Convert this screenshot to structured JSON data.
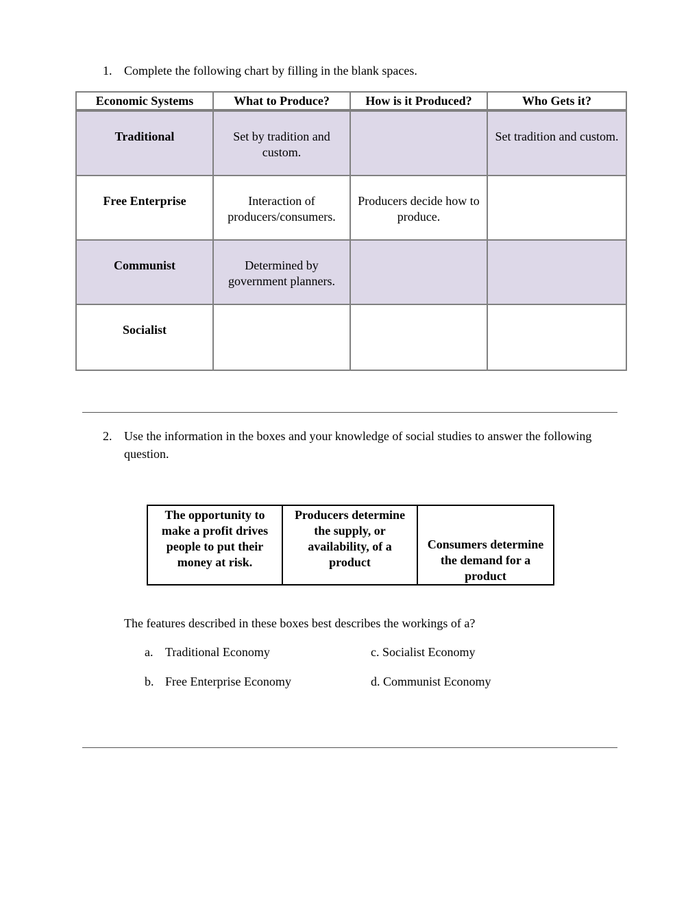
{
  "question1": {
    "number": "1.",
    "text": "Complete the following chart by filling in the blank spaces.",
    "table": {
      "headers": [
        "Economic Systems",
        "What to Produce?",
        "How is it Produced?",
        "Who Gets it?"
      ],
      "rows": [
        {
          "system": "Traditional",
          "what": "Set by tradition and custom.",
          "how": "",
          "who": "Set tradition and custom."
        },
        {
          "system": "Free Enterprise",
          "what": "Interaction of producers/consumers.",
          "how": "Producers decide how to produce.",
          "who": ""
        },
        {
          "system": "Communist",
          "what": "Determined by government planners.",
          "how": "",
          "who": ""
        },
        {
          "system": "Socialist",
          "what": "",
          "how": "",
          "who": ""
        }
      ],
      "shade_color": "#ddd8e8",
      "border_color": "#808080"
    }
  },
  "question2": {
    "number": "2.",
    "text": "Use the information in the boxes and your knowledge of social studies to answer the following question.",
    "boxes": [
      "The opportunity to make a profit drives people to put their money at risk.",
      "Producers determine the supply, or availability, of a product",
      "Consumers determine the demand for a product"
    ],
    "stem": "The features described in these boxes best describes the workings of a?",
    "options": [
      {
        "letter": "a.",
        "text": "Traditional Economy"
      },
      {
        "letter": "b.",
        "text": "Free Enterprise Economy"
      },
      {
        "letter": "c.",
        "text": "Socialist Economy"
      },
      {
        "letter": "d.",
        "text": "Communist Economy"
      }
    ]
  }
}
